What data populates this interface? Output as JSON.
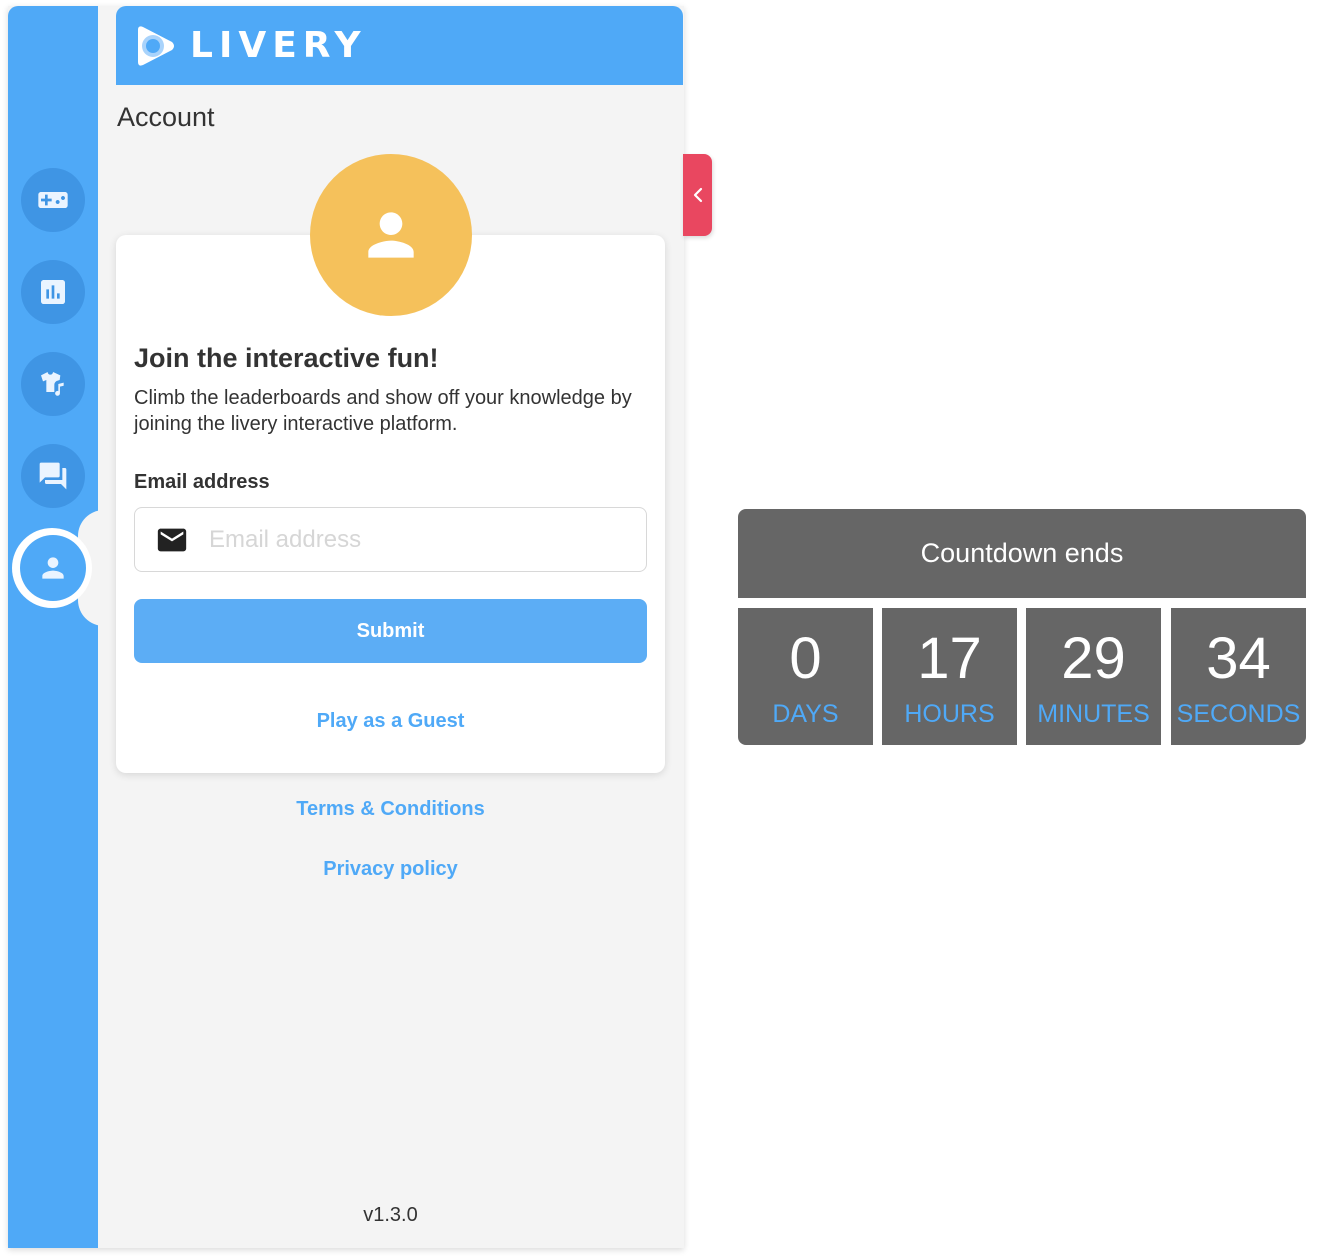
{
  "brand": {
    "name": "LIVERY"
  },
  "page": {
    "title": "Account"
  },
  "nav": {
    "items": [
      {
        "icon": "gamepad-icon"
      },
      {
        "icon": "bar-chart-icon"
      },
      {
        "icon": "shirt-music-icon"
      },
      {
        "icon": "chat-icon"
      },
      {
        "icon": "person-icon",
        "active": true
      }
    ]
  },
  "card": {
    "title": "Join the interactive fun!",
    "description": "Climb the leaderboards and show off your knowledge by joining the livery interactive platform.",
    "email_label": "Email address",
    "email_placeholder": "Email address",
    "email_value": "",
    "submit_label": "Submit",
    "guest_label": "Play as a Guest"
  },
  "footer": {
    "terms_label": "Terms & Conditions",
    "privacy_label": "Privacy policy",
    "version": "v1.3.0"
  },
  "countdown": {
    "title": "Countdown ends",
    "cells": [
      {
        "value": "0",
        "unit": "DAYS"
      },
      {
        "value": "17",
        "unit": "HOURS"
      },
      {
        "value": "29",
        "unit": "MINUTES"
      },
      {
        "value": "34",
        "unit": "SECONDS"
      }
    ]
  },
  "colors": {
    "primary": "#4fa9f7",
    "avatar": "#f5c15b",
    "collapse_tab": "#e94760",
    "countdown_bg": "#666666"
  }
}
